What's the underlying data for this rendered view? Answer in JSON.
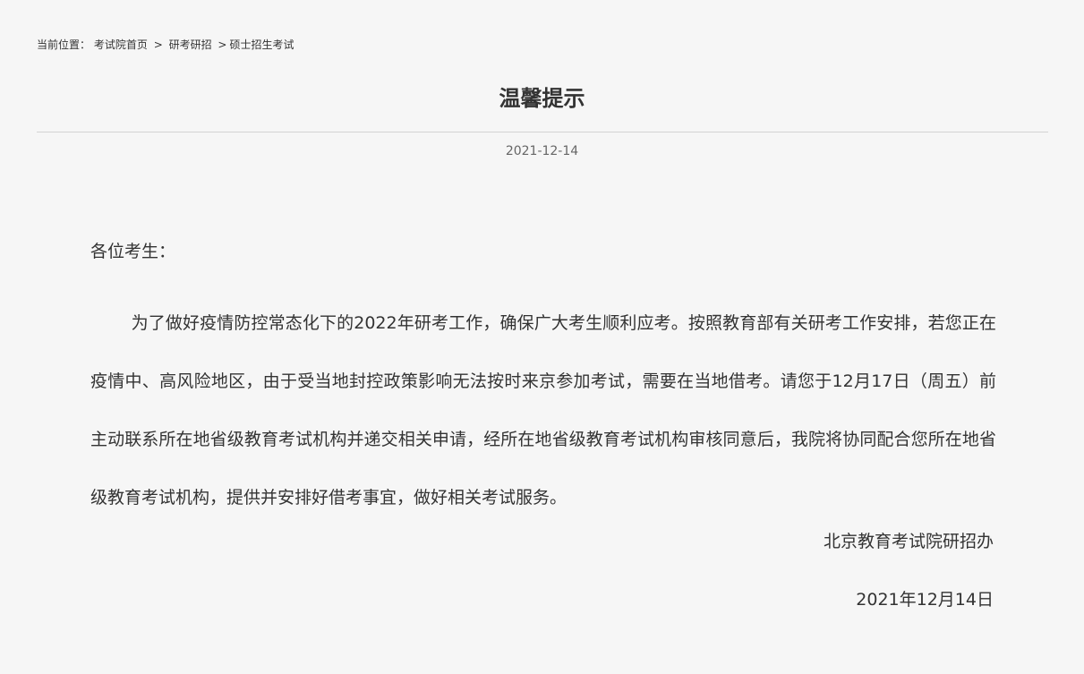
{
  "breadcrumb": {
    "prefix": "当前位置：",
    "items": [
      "考试院首页",
      "研考研招",
      "硕士招生考试"
    ],
    "separator": ">"
  },
  "article": {
    "title": "温馨提示",
    "date": "2021-12-14",
    "greeting": "各位考生：",
    "body": "为了做好疫情防控常态化下的2022年研考工作，确保广大考生顺利应考。按照教育部有关研考工作安排，若您正在疫情中、高风险地区，由于受当地封控政策影响无法按时来京参加考试，需要在当地借考。请您于12月17日（周五）前主动联系所在地省级教育考试机构并递交相关申请，经所在地省级教育考试机构审核同意后，我院将协同配合您所在地省级教育考试机构，提供并安排好借考事宜，做好相关考试服务。",
    "signature": "北京教育考试院研招办",
    "signature_date": "2021年12月14日"
  }
}
